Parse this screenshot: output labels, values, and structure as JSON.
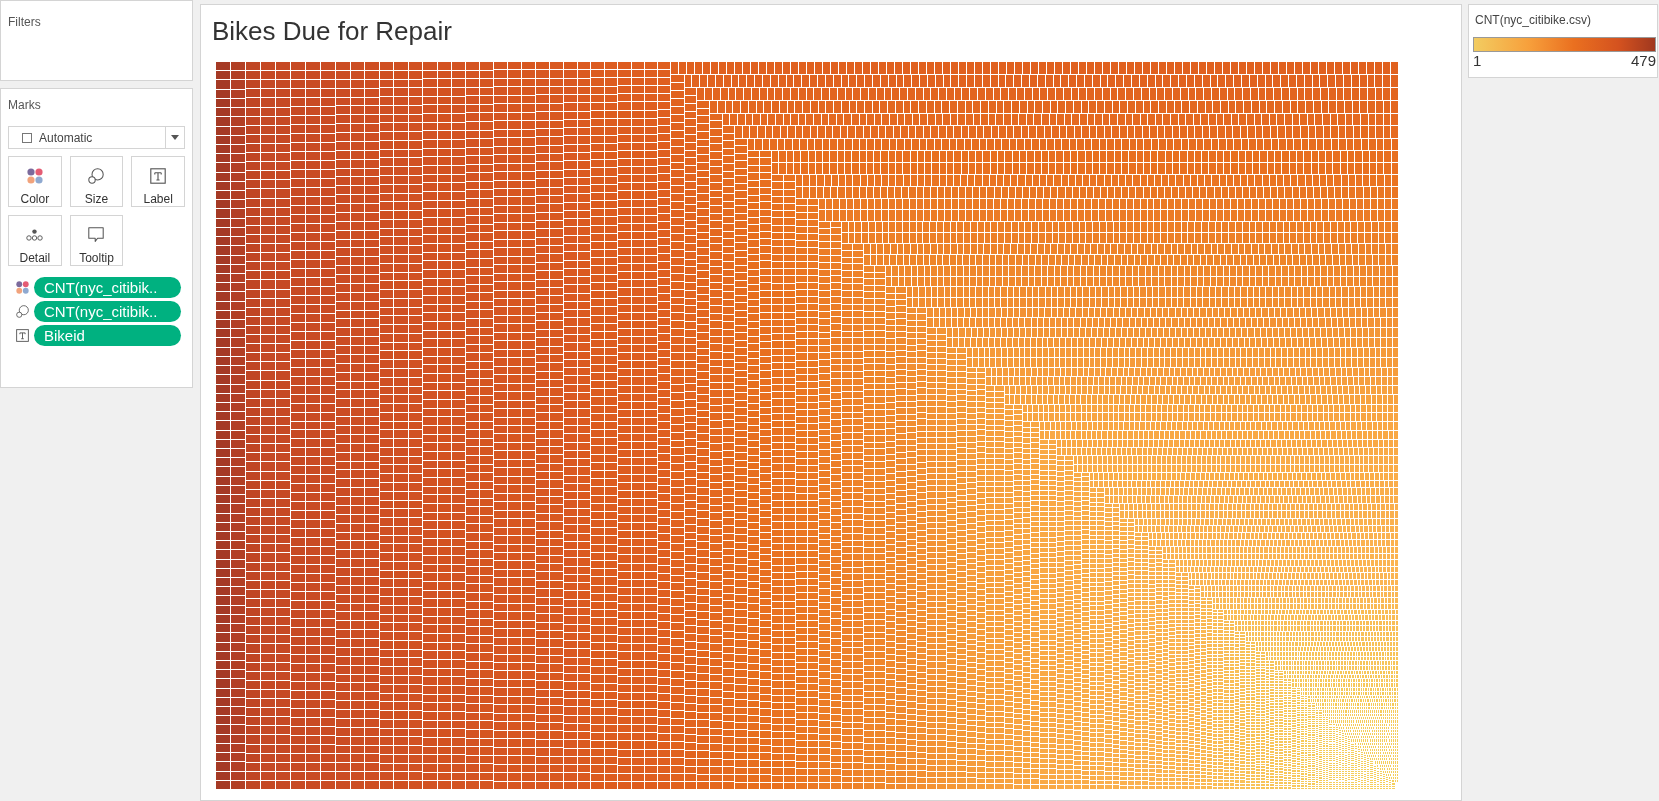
{
  "filters_card": {
    "title": "Filters"
  },
  "marks_card": {
    "title": "Marks",
    "mark_type": {
      "value": "Automatic"
    },
    "buttons": [
      {
        "kind": "color",
        "label": "Color"
      },
      {
        "kind": "size",
        "label": "Size"
      },
      {
        "kind": "label",
        "label": "Label"
      },
      {
        "kind": "detail",
        "label": "Detail"
      },
      {
        "kind": "tooltip",
        "label": "Tooltip"
      }
    ],
    "fields": [
      {
        "kind": "color",
        "label": "CNT(nyc_citibik.."
      },
      {
        "kind": "size",
        "label": "CNT(nyc_citibik.."
      },
      {
        "kind": "label",
        "label": "Bikeid"
      }
    ]
  },
  "worksheet": {
    "title": "Bikes Due for Repair"
  },
  "legend": {
    "title": "CNT(nyc_citibike.csv)",
    "min": "1",
    "max": "479"
  }
}
